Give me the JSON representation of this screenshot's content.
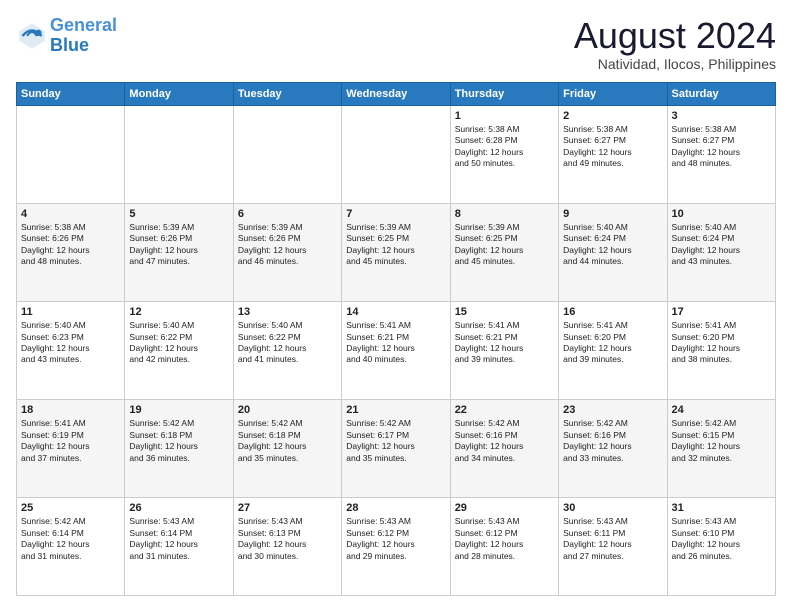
{
  "logo": {
    "line1": "General",
    "line2": "Blue"
  },
  "title": "August 2024",
  "subtitle": "Natividad, Ilocos, Philippines",
  "days_of_week": [
    "Sunday",
    "Monday",
    "Tuesday",
    "Wednesday",
    "Thursday",
    "Friday",
    "Saturday"
  ],
  "weeks": [
    [
      {
        "day": "",
        "info": ""
      },
      {
        "day": "",
        "info": ""
      },
      {
        "day": "",
        "info": ""
      },
      {
        "day": "",
        "info": ""
      },
      {
        "day": "1",
        "info": "Sunrise: 5:38 AM\nSunset: 6:28 PM\nDaylight: 12 hours\nand 50 minutes."
      },
      {
        "day": "2",
        "info": "Sunrise: 5:38 AM\nSunset: 6:27 PM\nDaylight: 12 hours\nand 49 minutes."
      },
      {
        "day": "3",
        "info": "Sunrise: 5:38 AM\nSunset: 6:27 PM\nDaylight: 12 hours\nand 48 minutes."
      }
    ],
    [
      {
        "day": "4",
        "info": "Sunrise: 5:38 AM\nSunset: 6:26 PM\nDaylight: 12 hours\nand 48 minutes."
      },
      {
        "day": "5",
        "info": "Sunrise: 5:39 AM\nSunset: 6:26 PM\nDaylight: 12 hours\nand 47 minutes."
      },
      {
        "day": "6",
        "info": "Sunrise: 5:39 AM\nSunset: 6:26 PM\nDaylight: 12 hours\nand 46 minutes."
      },
      {
        "day": "7",
        "info": "Sunrise: 5:39 AM\nSunset: 6:25 PM\nDaylight: 12 hours\nand 45 minutes."
      },
      {
        "day": "8",
        "info": "Sunrise: 5:39 AM\nSunset: 6:25 PM\nDaylight: 12 hours\nand 45 minutes."
      },
      {
        "day": "9",
        "info": "Sunrise: 5:40 AM\nSunset: 6:24 PM\nDaylight: 12 hours\nand 44 minutes."
      },
      {
        "day": "10",
        "info": "Sunrise: 5:40 AM\nSunset: 6:24 PM\nDaylight: 12 hours\nand 43 minutes."
      }
    ],
    [
      {
        "day": "11",
        "info": "Sunrise: 5:40 AM\nSunset: 6:23 PM\nDaylight: 12 hours\nand 43 minutes."
      },
      {
        "day": "12",
        "info": "Sunrise: 5:40 AM\nSunset: 6:22 PM\nDaylight: 12 hours\nand 42 minutes."
      },
      {
        "day": "13",
        "info": "Sunrise: 5:40 AM\nSunset: 6:22 PM\nDaylight: 12 hours\nand 41 minutes."
      },
      {
        "day": "14",
        "info": "Sunrise: 5:41 AM\nSunset: 6:21 PM\nDaylight: 12 hours\nand 40 minutes."
      },
      {
        "day": "15",
        "info": "Sunrise: 5:41 AM\nSunset: 6:21 PM\nDaylight: 12 hours\nand 39 minutes."
      },
      {
        "day": "16",
        "info": "Sunrise: 5:41 AM\nSunset: 6:20 PM\nDaylight: 12 hours\nand 39 minutes."
      },
      {
        "day": "17",
        "info": "Sunrise: 5:41 AM\nSunset: 6:20 PM\nDaylight: 12 hours\nand 38 minutes."
      }
    ],
    [
      {
        "day": "18",
        "info": "Sunrise: 5:41 AM\nSunset: 6:19 PM\nDaylight: 12 hours\nand 37 minutes."
      },
      {
        "day": "19",
        "info": "Sunrise: 5:42 AM\nSunset: 6:18 PM\nDaylight: 12 hours\nand 36 minutes."
      },
      {
        "day": "20",
        "info": "Sunrise: 5:42 AM\nSunset: 6:18 PM\nDaylight: 12 hours\nand 35 minutes."
      },
      {
        "day": "21",
        "info": "Sunrise: 5:42 AM\nSunset: 6:17 PM\nDaylight: 12 hours\nand 35 minutes."
      },
      {
        "day": "22",
        "info": "Sunrise: 5:42 AM\nSunset: 6:16 PM\nDaylight: 12 hours\nand 34 minutes."
      },
      {
        "day": "23",
        "info": "Sunrise: 5:42 AM\nSunset: 6:16 PM\nDaylight: 12 hours\nand 33 minutes."
      },
      {
        "day": "24",
        "info": "Sunrise: 5:42 AM\nSunset: 6:15 PM\nDaylight: 12 hours\nand 32 minutes."
      }
    ],
    [
      {
        "day": "25",
        "info": "Sunrise: 5:42 AM\nSunset: 6:14 PM\nDaylight: 12 hours\nand 31 minutes."
      },
      {
        "day": "26",
        "info": "Sunrise: 5:43 AM\nSunset: 6:14 PM\nDaylight: 12 hours\nand 31 minutes."
      },
      {
        "day": "27",
        "info": "Sunrise: 5:43 AM\nSunset: 6:13 PM\nDaylight: 12 hours\nand 30 minutes."
      },
      {
        "day": "28",
        "info": "Sunrise: 5:43 AM\nSunset: 6:12 PM\nDaylight: 12 hours\nand 29 minutes."
      },
      {
        "day": "29",
        "info": "Sunrise: 5:43 AM\nSunset: 6:12 PM\nDaylight: 12 hours\nand 28 minutes."
      },
      {
        "day": "30",
        "info": "Sunrise: 5:43 AM\nSunset: 6:11 PM\nDaylight: 12 hours\nand 27 minutes."
      },
      {
        "day": "31",
        "info": "Sunrise: 5:43 AM\nSunset: 6:10 PM\nDaylight: 12 hours\nand 26 minutes."
      }
    ]
  ]
}
